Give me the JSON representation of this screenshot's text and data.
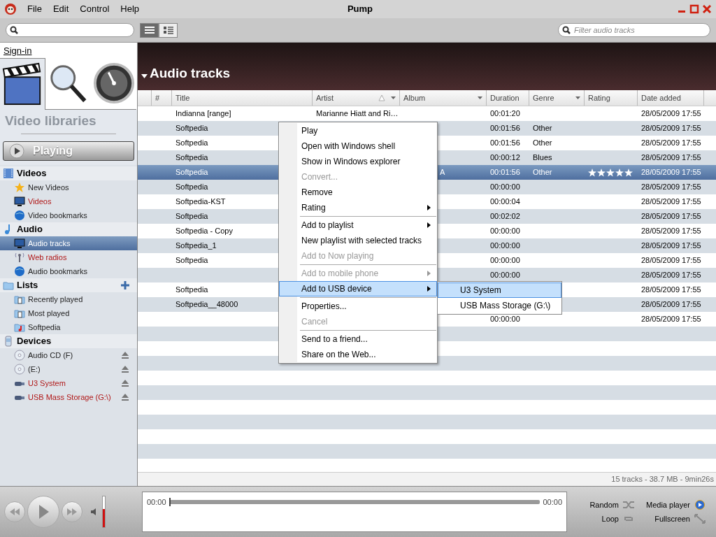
{
  "window": {
    "title": "Pump"
  },
  "menu": [
    "File",
    "Edit",
    "Control",
    "Help"
  ],
  "toolbar": {
    "views": [
      {
        "selected": true
      },
      {
        "selected": false
      }
    ],
    "filter": {
      "placeholder": "Filter audio tracks"
    }
  },
  "sidebar": {
    "sign_in": "Sign-in",
    "tabs": [
      {
        "selected": true
      },
      {
        "selected": false
      },
      {
        "selected": false
      }
    ],
    "library_title": "Video libraries",
    "playing": "Playing",
    "items": [
      {
        "kind": "header",
        "label": "Videos",
        "selected": false,
        "accent": false
      },
      {
        "kind": "item",
        "label": "New Videos",
        "selected": false,
        "accent": false
      },
      {
        "kind": "item",
        "label": "Videos",
        "selected": false,
        "accent": true
      },
      {
        "kind": "item",
        "label": "Video bookmarks",
        "selected": false,
        "accent": false
      },
      {
        "kind": "header",
        "label": "Audio",
        "selected": false,
        "accent": false
      },
      {
        "kind": "item",
        "label": "Audio tracks",
        "selected": true,
        "accent": false
      },
      {
        "kind": "item",
        "label": "Web radios",
        "selected": false,
        "accent": true
      },
      {
        "kind": "item",
        "label": "Audio bookmarks",
        "selected": false,
        "accent": false
      },
      {
        "kind": "header",
        "label": "Lists",
        "selected": false,
        "accent": false,
        "add": true
      },
      {
        "kind": "item",
        "label": "Recently played",
        "selected": false,
        "accent": false
      },
      {
        "kind": "item",
        "label": "Most played",
        "selected": false,
        "accent": false
      },
      {
        "kind": "item",
        "label": "Softpedia",
        "selected": false,
        "accent": false
      },
      {
        "kind": "header",
        "label": "Devices",
        "selected": false,
        "accent": false
      },
      {
        "kind": "item",
        "label": "Audio CD (F)",
        "selected": false,
        "accent": false,
        "eject": true
      },
      {
        "kind": "item",
        "label": "(E:)",
        "selected": false,
        "accent": false,
        "eject": true
      },
      {
        "kind": "item",
        "label": "U3 System",
        "selected": false,
        "accent": true,
        "eject": true
      },
      {
        "kind": "item",
        "label": "USB Mass Storage (G:\\)",
        "selected": false,
        "accent": true,
        "eject": true
      }
    ]
  },
  "main": {
    "title": "Audio tracks",
    "columns": [
      "#",
      "Title",
      "Artist",
      "Album",
      "Duration",
      "Genre",
      "Rating",
      "Date added"
    ],
    "rows": [
      {
        "title": "Indianna [range]",
        "artist": "Marianne Hiatt and Ri…",
        "duration": "00:01:20",
        "date": "28/05/2009 17:55",
        "selected": false
      },
      {
        "title": "Softpedia",
        "duration": "00:01:56",
        "genre": "Other",
        "date": "28/05/2009 17:55",
        "selected": false
      },
      {
        "title": "Softpedia",
        "duration": "00:01:56",
        "genre": "Other",
        "date": "28/05/2009 17:55",
        "selected": false
      },
      {
        "title": "Softpedia",
        "duration": "00:00:12",
        "genre": "Blues",
        "date": "28/05/2009 17:55",
        "selected": false
      },
      {
        "title": "Softpedia",
        "album": "A",
        "duration": "00:01:56",
        "genre": "Other",
        "stars": 5,
        "date": "28/05/2009 17:55",
        "selected": true
      },
      {
        "title": "Softpedia",
        "duration": "00:00:00",
        "date": "28/05/2009 17:55",
        "selected": false
      },
      {
        "title": "Softpedia-KST",
        "duration": "00:00:04",
        "date": "28/05/2009 17:55",
        "selected": false
      },
      {
        "title": "Softpedia",
        "duration": "00:02:02",
        "date": "28/05/2009 17:55",
        "selected": false
      },
      {
        "title": "Softpedia - Copy",
        "duration": "00:00:00",
        "date": "28/05/2009 17:55",
        "selected": false
      },
      {
        "title": "Softpedia_1",
        "duration": "00:00:00",
        "date": "28/05/2009 17:55",
        "selected": false
      },
      {
        "title": "Softpedia",
        "duration": "00:00:00",
        "date": "28/05/2009 17:55",
        "selected": false
      },
      {
        "duration": "00:00:00",
        "date": "28/05/2009 17:55",
        "selected": false
      },
      {
        "title": "Softpedia",
        "date": "28/05/2009 17:55",
        "selected": false
      },
      {
        "title": "Softpedia__48000",
        "date": "28/05/2009 17:55",
        "selected": false
      },
      {
        "duration": "00:00:00",
        "date": "28/05/2009 17:55",
        "selected": false
      }
    ],
    "status": "15 tracks - 38.7 MB - 9min26s"
  },
  "context_menu": [
    {
      "label": "Play",
      "disabled": false,
      "submenu": false,
      "separator_before": false,
      "selected": false
    },
    {
      "label": "Open with Windows shell",
      "disabled": false,
      "submenu": false,
      "separator_before": false,
      "selected": false
    },
    {
      "label": "Show in Windows explorer",
      "disabled": false,
      "submenu": false,
      "separator_before": false,
      "selected": false
    },
    {
      "label": "Convert...",
      "disabled": true,
      "submenu": false,
      "separator_before": false,
      "selected": false
    },
    {
      "label": "Remove",
      "disabled": false,
      "submenu": false,
      "separator_before": false,
      "selected": false
    },
    {
      "label": "Rating",
      "disabled": false,
      "submenu": true,
      "separator_before": false,
      "selected": false
    },
    {
      "label": "Add to playlist",
      "disabled": false,
      "submenu": true,
      "separator_before": true,
      "selected": false
    },
    {
      "label": "New playlist with selected tracks",
      "disabled": false,
      "submenu": false,
      "separator_before": false,
      "selected": false
    },
    {
      "label": "Add to Now playing",
      "disabled": true,
      "submenu": false,
      "separator_before": false,
      "selected": false
    },
    {
      "label": "Add to mobile phone",
      "disabled": true,
      "submenu": true,
      "separator_before": true,
      "selected": false
    },
    {
      "label": "Add to USB device",
      "disabled": false,
      "submenu": true,
      "separator_before": false,
      "selected": true
    },
    {
      "label": "Properties...",
      "disabled": false,
      "submenu": false,
      "separator_before": true,
      "selected": false
    },
    {
      "label": "Cancel",
      "disabled": true,
      "submenu": false,
      "separator_before": false,
      "selected": false
    },
    {
      "label": "Send to a friend...",
      "disabled": false,
      "submenu": false,
      "separator_before": true,
      "selected": false
    },
    {
      "label": "Share on the Web...",
      "disabled": false,
      "submenu": false,
      "separator_before": false,
      "selected": false
    }
  ],
  "submenu": [
    {
      "label": "U3 System",
      "selected": true
    },
    {
      "label": "USB Mass Storage (G:\\)",
      "selected": false
    }
  ],
  "player": {
    "volume": {
      "level": 0.6
    },
    "seek": {
      "level": 0
    },
    "time_start": "00:00",
    "time_end": "00:00",
    "options": [
      "Random",
      "Media player",
      "Loop",
      "Fullscreen"
    ]
  }
}
